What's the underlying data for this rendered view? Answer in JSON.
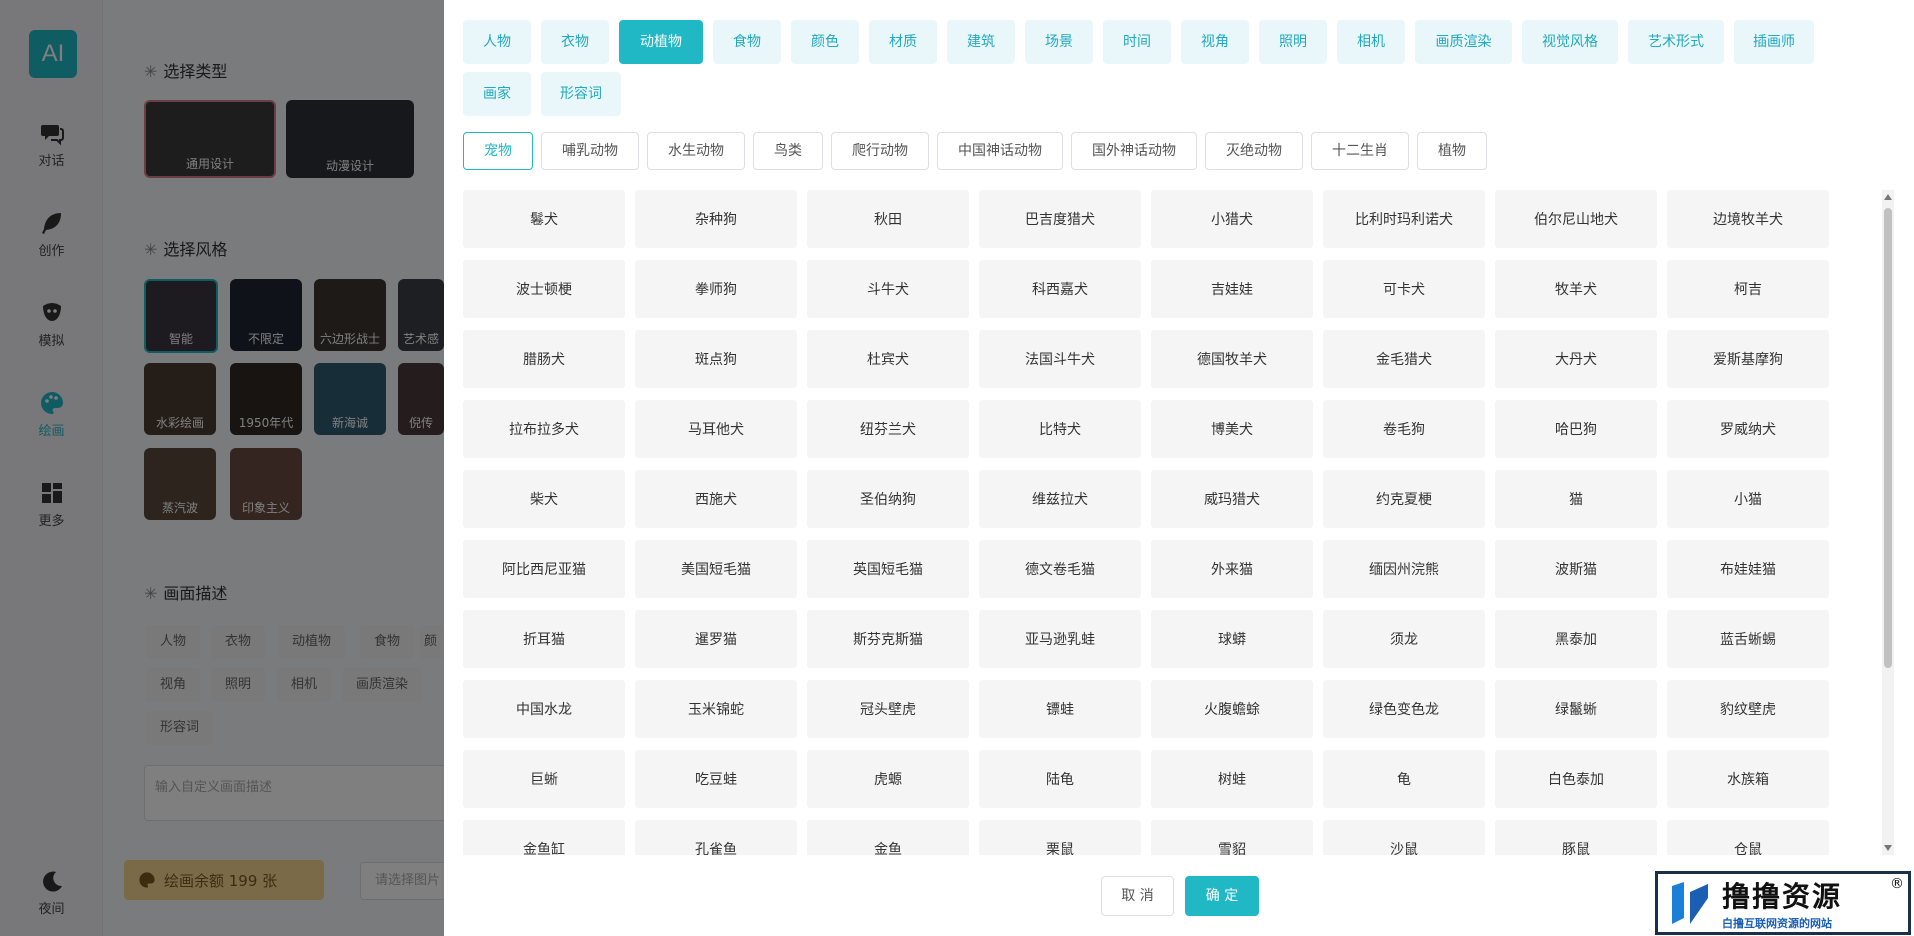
{
  "sidebar": {
    "logo": "AI",
    "items": [
      {
        "label": "对话",
        "icon": "chat-icon"
      },
      {
        "label": "创作",
        "icon": "feather-icon"
      },
      {
        "label": "模拟",
        "icon": "mask-icon"
      },
      {
        "label": "绘画",
        "icon": "palette-icon"
      },
      {
        "label": "更多",
        "icon": "grid-icon"
      }
    ],
    "night_label": "夜间",
    "night_icon": "moon-icon"
  },
  "background": {
    "type_section_title": "选择类型",
    "types": [
      "通用设计",
      "动漫设计"
    ],
    "style_section_title": "选择风格",
    "styles": [
      "智能",
      "不限定",
      "六边形战士",
      "艺术感",
      "水彩绘画",
      "1950年代",
      "新海诚",
      "倪传",
      "蒸汽波",
      "印象主义"
    ],
    "desc_section_title": "画面描述",
    "desc_chips": [
      "人物",
      "衣物",
      "动植物",
      "食物",
      "颜",
      "视角",
      "照明",
      "相机",
      "画质渲染",
      "形容词"
    ],
    "desc_placeholder": "输入自定义画面描述",
    "balance_label": "绘画余额 199 张",
    "select_image_placeholder": "请选择图片"
  },
  "drawer": {
    "categories": [
      "人物",
      "衣物",
      "动植物",
      "食物",
      "颜色",
      "材质",
      "建筑",
      "场景",
      "时间",
      "视角",
      "照明",
      "相机",
      "画质渲染",
      "视觉风格",
      "艺术形式",
      "插画师",
      "画家",
      "形容词"
    ],
    "active_category": "动植物",
    "subcategories": [
      "宠物",
      "哺乳动物",
      "水生动物",
      "鸟类",
      "爬行动物",
      "中国神话动物",
      "国外神话动物",
      "灭绝动物",
      "十二生肖",
      "植物"
    ],
    "active_subcategory": "宠物",
    "items": [
      "鬈犬",
      "杂种狗",
      "秋田",
      "巴吉度猎犬",
      "小猎犬",
      "比利时玛利诺犬",
      "伯尔尼山地犬",
      "边境牧羊犬",
      "波士顿梗",
      "拳师狗",
      "斗牛犬",
      "科西嘉犬",
      "吉娃娃",
      "可卡犬",
      "牧羊犬",
      "柯吉",
      "腊肠犬",
      "斑点狗",
      "杜宾犬",
      "法国斗牛犬",
      "德国牧羊犬",
      "金毛猎犬",
      "大丹犬",
      "爱斯基摩狗",
      "拉布拉多犬",
      "马耳他犬",
      "纽芬兰犬",
      "比特犬",
      "博美犬",
      "卷毛狗",
      "哈巴狗",
      "罗威纳犬",
      "柴犬",
      "西施犬",
      "圣伯纳狗",
      "维兹拉犬",
      "威玛猎犬",
      "约克夏梗",
      "猫",
      "小猫",
      "阿比西尼亚猫",
      "美国短毛猫",
      "英国短毛猫",
      "德文卷毛猫",
      "外来猫",
      "缅因州浣熊",
      "波斯猫",
      "布娃娃猫",
      "折耳猫",
      "暹罗猫",
      "斯芬克斯猫",
      "亚马逊乳蛙",
      "球蟒",
      "须龙",
      "黑泰加",
      "蓝舌蜥蜴",
      "中国水龙",
      "玉米锦蛇",
      "冠头壁虎",
      "镖蛙",
      "火腹蟾蜍",
      "绿色变色龙",
      "绿鬣蜥",
      "豹纹壁虎",
      "巨蜥",
      "吃豆蛙",
      "虎螈",
      "陆龟",
      "树蛙",
      "龟",
      "白色泰加",
      "水族箱",
      "金鱼缸",
      "孔雀鱼",
      "金鱼",
      "栗鼠",
      "雪貂",
      "沙鼠",
      "豚鼠",
      "仓鼠"
    ],
    "cancel_label": "取 消",
    "ok_label": "确 定"
  },
  "watermark": {
    "title": "撸撸资源",
    "subtitle": "白撸互联网资源的网站",
    "reg": "®"
  },
  "colors": {
    "accent": "#21b8c6",
    "accent_light": "#eaf7fa",
    "balance_bg": "#f7d48e"
  }
}
